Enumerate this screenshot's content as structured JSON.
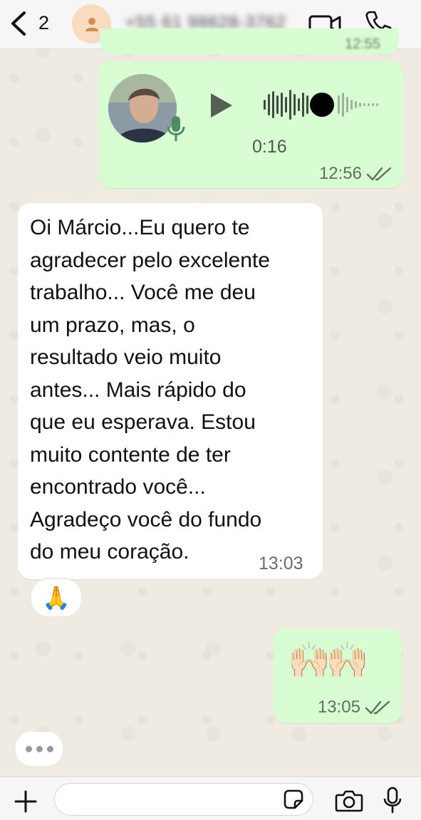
{
  "header": {
    "back_count": "2",
    "contact_name": "+55 61 98628-3762",
    "icons": [
      "chevron-left-icon",
      "person-icon",
      "video-call-icon",
      "phone-icon"
    ]
  },
  "messages": [
    {
      "type": "outgoing-partial",
      "time": "12:55"
    },
    {
      "type": "voice",
      "direction": "outgoing",
      "duration": "0:16",
      "time": "12:56",
      "status": "read"
    },
    {
      "type": "text",
      "direction": "incoming",
      "lines": [
        "Oi Márcio...Eu quero te",
        "agradecer pelo excelente",
        "trabalho... Você me deu",
        "um prazo, mas, o",
        "resultado veio muito",
        "antes... Mais rápido do",
        "que eu esperava. Estou",
        "muito contente de ter",
        "encontrado você...",
        "Agradeço você do fundo",
        "do meu coração."
      ],
      "time": "13:03",
      "reaction": "🙏"
    },
    {
      "type": "emoji",
      "direction": "outgoing",
      "content": "🙌🏻🙌🏻",
      "time": "13:05",
      "status": "read"
    }
  ],
  "input": {
    "placeholder": ""
  },
  "colors": {
    "outgoing": "#d9fdd3",
    "incoming": "#ffffff",
    "background": "#efeae2",
    "read_ticks": "#5f6f60"
  }
}
